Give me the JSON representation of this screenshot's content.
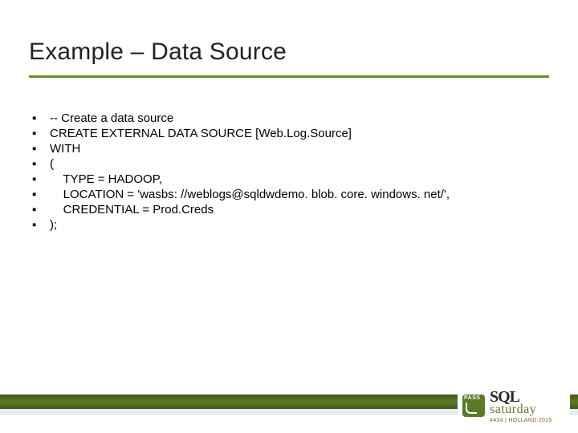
{
  "title": "Example – Data Source",
  "code": {
    "l0": "-- Create a data source",
    "l1": "CREATE EXTERNAL DATA SOURCE [Web.Log.Source]",
    "l2": "WITH",
    "l3": "(",
    "l4_pre": "    TYPE ",
    "l4_post": " HADOOP,",
    "l5_pre": "    LOCATION ",
    "l5_str": "'wasbs: //weblogs@sqldwdemo. blob. core. windows. net/'",
    "l5_post": ",",
    "l6_pre": "    CREDENTIAL ",
    "l6_post": " Prod.Creds",
    "l7": ");",
    "eq": "="
  },
  "logo": {
    "line1": "SQL",
    "line2": "saturday",
    "sub": "#434 | HOLLAND 2015"
  }
}
